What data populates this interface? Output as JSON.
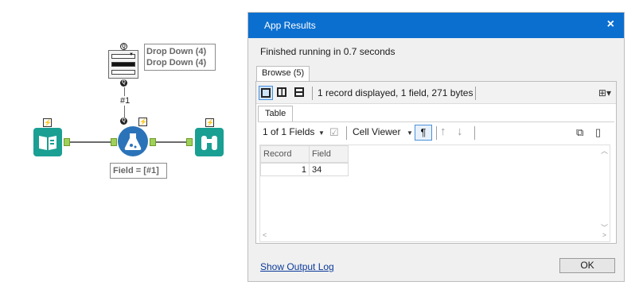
{
  "workflow": {
    "dropdown_label_1": "Drop Down (4)",
    "dropdown_label_2": "Drop Down (4)",
    "hash_label": "#1",
    "formula_label": "Field = [#1]",
    "badge_q": "Q",
    "badge_bolt": "⚡"
  },
  "dialog": {
    "title": "App Results",
    "close": "×",
    "status": "Finished running in 0.7 seconds",
    "browse_tab": "Browse (5)",
    "record_info": "1 record displayed, 1 field, 271 bytes",
    "table_tab": "Table",
    "fields_selector": "1 of 1 Fields",
    "cell_viewer": "Cell Viewer",
    "pilcrow": "¶",
    "columns": [
      "Record",
      "Field"
    ],
    "rows": [
      [
        "1",
        "34"
      ]
    ],
    "output_log": "Show Output Log",
    "ok": "OK"
  },
  "colors": {
    "titlebar": "#0b6fd0",
    "tool_teal": "#1a9f93",
    "tool_blue": "#2b73b9",
    "anchor_green": "#9fd15a"
  }
}
